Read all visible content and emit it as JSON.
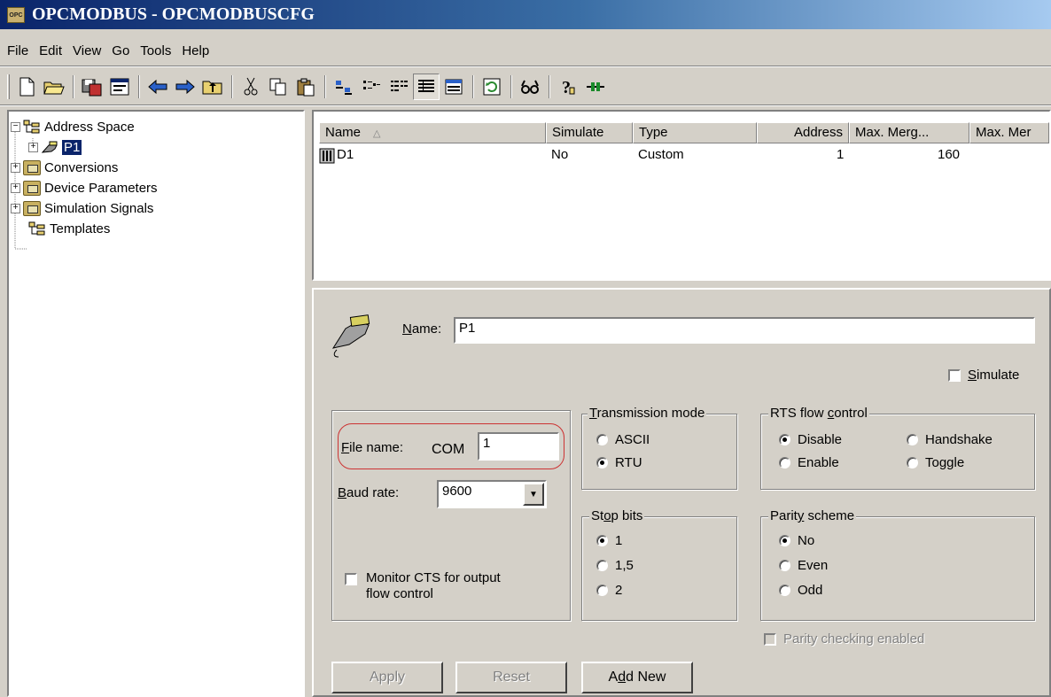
{
  "window": {
    "title": "OPCMODBUS - OPCMODBUSCFG",
    "icon": "opc-app-icon"
  },
  "menu": [
    "File",
    "Edit",
    "View",
    "Go",
    "Tools",
    "Help"
  ],
  "toolbar": {
    "icons": [
      "new-icon",
      "open-icon",
      "save-icon",
      "properties-icon",
      "back-icon",
      "forward-icon",
      "up-folder-icon",
      "cut-icon",
      "copy-icon",
      "paste-icon",
      "large-icons-icon",
      "small-icons-icon",
      "list-view-icon",
      "details-view-icon",
      "report-view-icon",
      "refresh-icon",
      "monitor-icon",
      "help-icon",
      "connect-icon"
    ]
  },
  "tree": {
    "root": "Address Space",
    "child": "P1",
    "items": [
      "Conversions",
      "Device Parameters",
      "Simulation Signals",
      "Templates"
    ]
  },
  "list": {
    "columns": [
      "Name",
      "Simulate",
      "Type",
      "Address",
      "Max. Merg...",
      "Max. Mer"
    ],
    "rows": [
      {
        "name": "D1",
        "simulate": "No",
        "type": "Custom",
        "address": "1",
        "max_merge": "160"
      }
    ]
  },
  "props": {
    "name_label": "Name:",
    "name_value": "P1",
    "simulate_label": "Simulate",
    "file_name_label": "File name:",
    "com_prefix": "COM",
    "file_name_value": "1",
    "baud_rate_label": "Baud rate:",
    "baud_rate_value": "9600",
    "monitor_cts_line1": "Monitor CTS for output",
    "monitor_cts_line2": "flow control",
    "transmission": {
      "title": "Transmission mode",
      "options": [
        "ASCII",
        "RTU"
      ],
      "selected": "RTU"
    },
    "rts": {
      "title": "RTS flow control",
      "options": [
        "Disable",
        "Handshake",
        "Enable",
        "Toggle"
      ],
      "selected": "Disable"
    },
    "stop_bits": {
      "title": "Stop bits",
      "options": [
        "1",
        "1,5",
        "2"
      ],
      "selected": "1"
    },
    "parity": {
      "title": "Parity scheme",
      "options": [
        "No",
        "Even",
        "Odd"
      ],
      "selected": "No"
    },
    "parity_checking_label": "Parity checking enabled",
    "buttons": {
      "apply": "Apply",
      "reset": "Reset",
      "add_new": "Add New"
    }
  },
  "colors": {
    "title_start": "#0a246a",
    "title_end": "#a6caf0",
    "face": "#d4d0c8",
    "highlight_oval": "#cc3333"
  }
}
